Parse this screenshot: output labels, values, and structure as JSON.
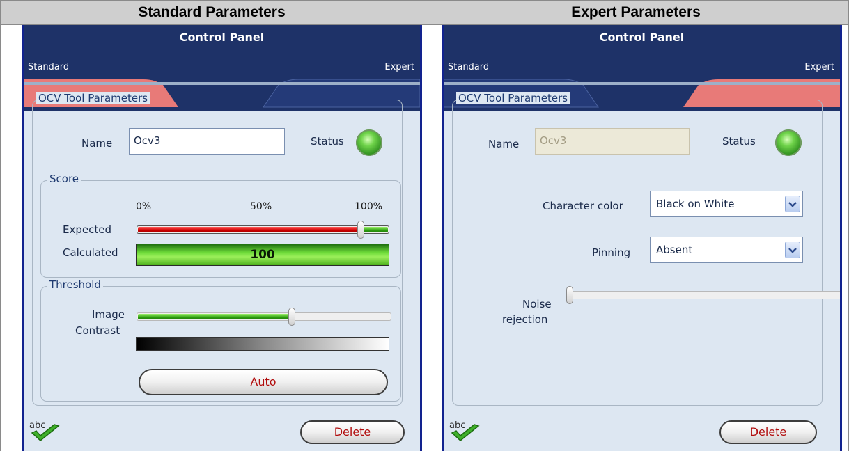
{
  "columns": {
    "left_header": "Standard Parameters",
    "right_header": "Expert Parameters"
  },
  "panel": {
    "title": "Control Panel",
    "tab_standard": "Standard",
    "tab_expert": "Expert",
    "group_title": "OCV Tool Parameters",
    "name_label": "Name",
    "name_value": "Ocv3",
    "status_label": "Status",
    "delete_label": "Delete",
    "abc_icon_text": "abc"
  },
  "standard": {
    "score_legend": "Score",
    "pct_0": "0%",
    "pct_50": "50%",
    "pct_100": "100%",
    "expected_label": "Expected",
    "expected_value_fraction": 0.89,
    "calculated_label": "Calculated",
    "calculated_value": "100",
    "threshold_legend": "Threshold",
    "image_contrast_label_1": "Image",
    "image_contrast_label_2": "Contrast",
    "image_contrast_fraction": 0.61,
    "auto_label": "Auto"
  },
  "expert": {
    "character_color_label": "Character color",
    "character_color_value": "Black on White",
    "pinning_label": "Pinning",
    "pinning_value": "Absent",
    "noise_label_1": "Noise",
    "noise_label_2": "rejection",
    "noise_fraction": 0.0
  },
  "colors": {
    "title_bar": "#1e3268",
    "tab_active": "#e87a78",
    "panel_bg": "#dde7f2",
    "border_blue": "#12238f",
    "delete_text": "#b10c0c"
  }
}
